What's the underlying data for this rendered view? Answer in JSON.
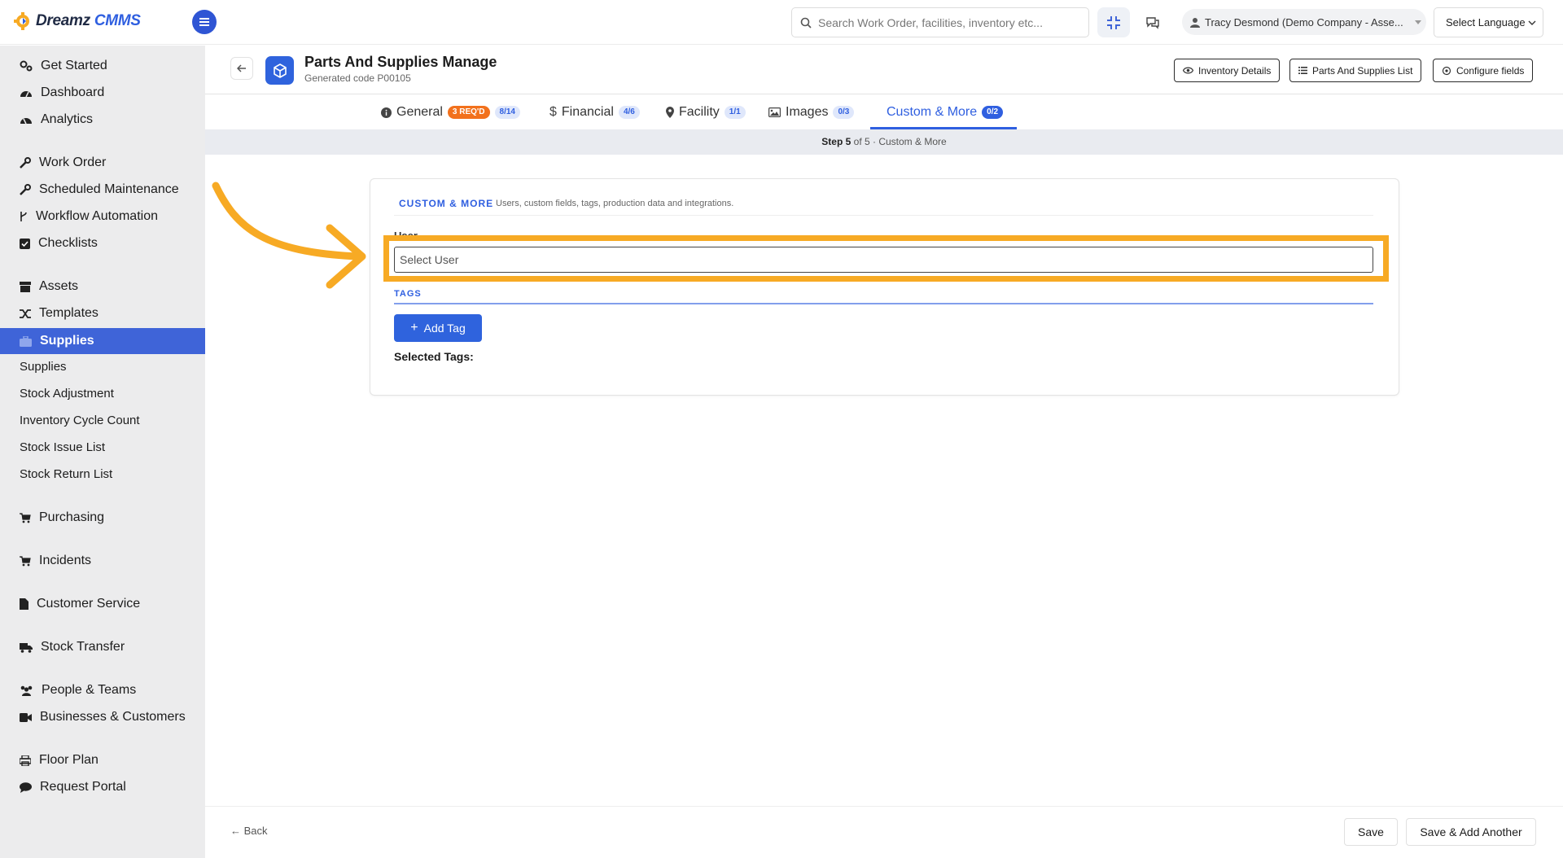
{
  "brand": {
    "name_part1": "Dreamz",
    "name_part2": "CMMS",
    "accent": "#2f5fe0",
    "highlight": "#f7aa24"
  },
  "topbar": {
    "search_placeholder": "Search Work Order, facilities, inventory etc...",
    "user_name": "Tracy Desmond (Demo Company - Asse...",
    "language": "Select Language",
    "icons": [
      "menu-icon",
      "search-icon",
      "scan-icon",
      "chat-icon",
      "user-icon",
      "chevron-down-icon"
    ]
  },
  "sidebar": {
    "items": [
      {
        "label": "Get Started",
        "icon": "gears-icon"
      },
      {
        "label": "Dashboard",
        "icon": "dashboard-icon"
      },
      {
        "label": "Analytics",
        "icon": "analytics-icon"
      },
      {
        "label": "Work Order",
        "icon": "wrench-icon"
      },
      {
        "label": "Scheduled Maintenance",
        "icon": "wrench-icon"
      },
      {
        "label": "Workflow Automation",
        "icon": "branch-icon"
      },
      {
        "label": "Checklists",
        "icon": "checkbox-icon"
      },
      {
        "label": "Assets",
        "icon": "archive-icon"
      },
      {
        "label": "Templates",
        "icon": "shuffle-icon"
      },
      {
        "label": "Supplies",
        "icon": "briefcase-icon"
      },
      {
        "label": "Purchasing",
        "icon": "cart-icon"
      },
      {
        "label": "Incidents",
        "icon": "cart-icon"
      },
      {
        "label": "Customer Service",
        "icon": "file-icon"
      },
      {
        "label": "Stock Transfer",
        "icon": "truck-icon"
      },
      {
        "label": "People & Teams",
        "icon": "users-icon"
      },
      {
        "label": "Businesses & Customers",
        "icon": "video-icon"
      },
      {
        "label": "Floor Plan",
        "icon": "printer-icon"
      },
      {
        "label": "Request Portal",
        "icon": "comment-icon"
      }
    ],
    "subitems": [
      "Supplies",
      "Stock Adjustment",
      "Inventory Cycle Count",
      "Stock Issue List",
      "Stock Return List"
    ]
  },
  "header": {
    "title": "Parts And Supplies Manage",
    "subtitle": "Generated code P00105",
    "buttons": [
      "Inventory Details",
      "Parts And Supplies List",
      "Configure fields"
    ]
  },
  "tabs": [
    {
      "label": "General",
      "req": "3 REQ'D",
      "count": "8/14"
    },
    {
      "label": "Financial",
      "count": "4/6"
    },
    {
      "label": "Facility",
      "count": "1/1"
    },
    {
      "label": "Images",
      "count": "0/3"
    },
    {
      "label": "Custom & More",
      "count": "0/2"
    }
  ],
  "step": {
    "bold": "Step 5",
    "rest": "of 5 · Custom & More"
  },
  "section": {
    "title": "CUSTOM & MORE",
    "description": "Users, custom fields, tags, production data and integrations.",
    "user_label": "User",
    "user_placeholder": "Select User",
    "tags_title": "TAGS",
    "add_tag": "Add Tag",
    "selected_tags": "Selected Tags:"
  },
  "footer": {
    "back": "Back",
    "save": "Save",
    "save_add": "Save & Add Another"
  }
}
